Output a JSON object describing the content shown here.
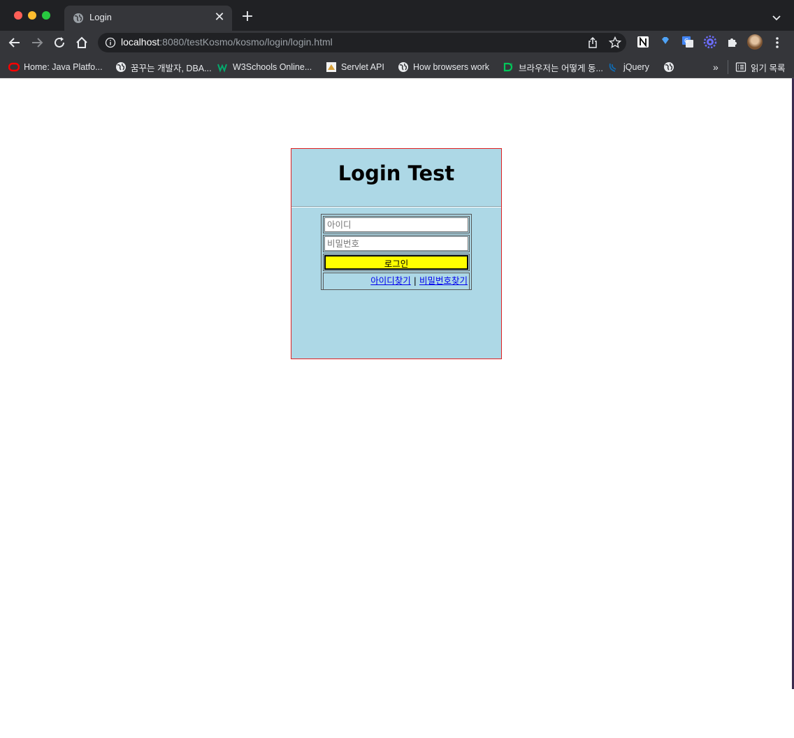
{
  "browser": {
    "tab": {
      "title": "Login",
      "close_glyph": "✕"
    },
    "new_tab_glyph": "+",
    "address": {
      "host": "localhost",
      "rest": ":8080/testKosmo/kosmo/login/login.html"
    },
    "bookmarks": [
      {
        "label": "Home: Java Platfo...",
        "icon": "oracle-icon"
      },
      {
        "label": "꿈꾸는 개발자, DBA...",
        "icon": "globe-icon"
      },
      {
        "label": "W3Schools Online...",
        "icon": "w3schools-icon"
      },
      {
        "label": "Servlet API",
        "icon": "servlet-icon"
      },
      {
        "label": "How browsers work",
        "icon": "globe-icon"
      },
      {
        "label": "브라우저는 어떻게 동...",
        "icon": "d2-icon"
      },
      {
        "label": "jQuery",
        "icon": "jquery-icon"
      },
      {
        "label": "",
        "icon": "globe-icon"
      }
    ],
    "overflow_glyph": "»",
    "reading_list_label": "읽기 목록"
  },
  "page": {
    "title": "Login Test",
    "id_placeholder": "아이디",
    "password_placeholder": "비밀번호",
    "login_button": "로그인",
    "find_id_link": "아이디찾기",
    "separator": "|",
    "find_password_link": "비밀번호찾기"
  },
  "colors": {
    "box_background": "#add8e6",
    "box_border": "#e02020",
    "button_background": "#ffff00",
    "link": "#0000ee",
    "chrome_dark": "#202124",
    "chrome_toolbar": "#35363a"
  }
}
